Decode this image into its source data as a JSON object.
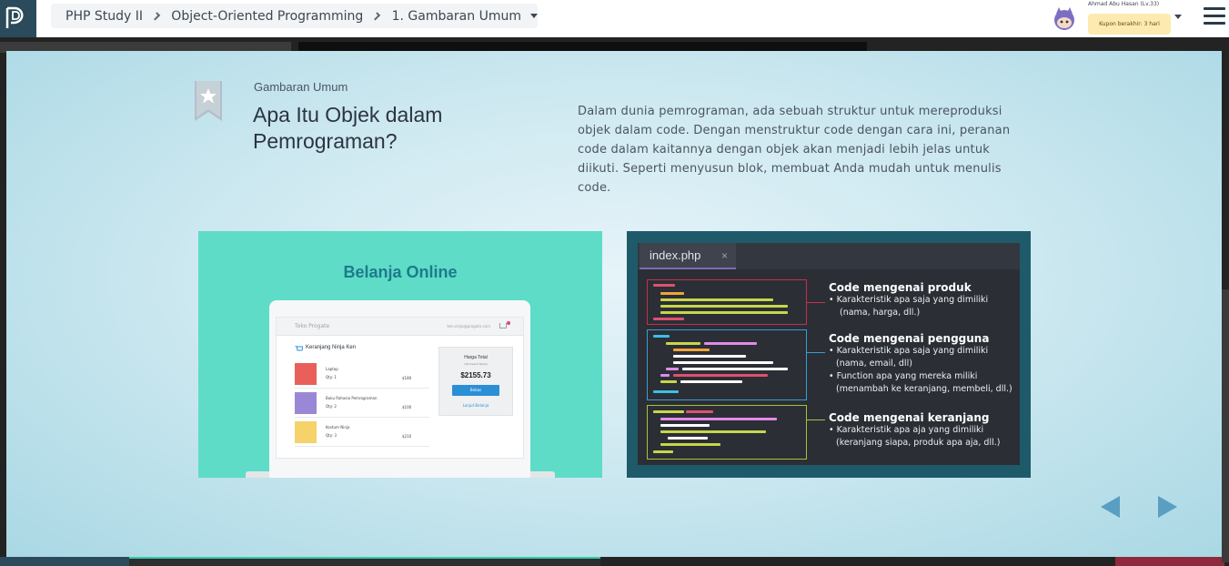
{
  "header": {
    "breadcrumb": {
      "course": "PHP Study II",
      "chapter": "Object-Oriented Programming",
      "lesson": "1. Gambaran Umum"
    },
    "user": {
      "name": "Ahmad Abu Hasan (Lv.33)",
      "coupon": "Kupon berakhir: 3 hari"
    }
  },
  "slide": {
    "subtitle": "Gambaran Umum",
    "title": "Apa Itu Objek dalam Pemrograman?",
    "description": "Dalam dunia pemrograman, ada sebuah struktur untuk mereproduksi objek dalam code. Dengan menstruktur code dengan cara ini, peranan code dalam kaitannya dengan objek akan menjadi lebih jelas untuk diikuti. Seperti menyusun blok, membuat Anda mudah untuk menulis code."
  },
  "shop_image": {
    "title": "Belanja Online",
    "store_name": "Toko Progate",
    "email": "ken.ninja@progate.com",
    "cart_title": "Keranjang Ninja Ken",
    "items": [
      {
        "name": "Laptop",
        "qty": "Qty: 1",
        "price": "$180",
        "color": "#e9605b"
      },
      {
        "name": "Buku Rahasia Pemrograman",
        "qty": "Qty: 2",
        "price": "$100",
        "color": "#9a87d6"
      },
      {
        "name": "Kostum Ninja",
        "qty": "Qty: 3",
        "price": "$210",
        "color": "#f5d26a"
      }
    ],
    "total_label": "Harga Total",
    "total_sub": "(Termasuk Pajak)",
    "total_amount": "$2155.73",
    "pay_button": "Bebas",
    "continue_link": "Lanjut Belanja"
  },
  "code_image": {
    "tab_name": "index.php",
    "tab_close": "×",
    "sections": [
      {
        "title": "Code mengenai produk",
        "lines": [
          "• Karakteristik apa saja yang dimiliki",
          "  (nama, harga, dll.)"
        ],
        "color": "#c2304f"
      },
      {
        "title": "Code mengenai pengguna",
        "lines": [
          "• Karakteristik apa saja yang dimiliki",
          "  (nama, email, dll)",
          "• Function apa yang mereka miliki",
          "  (menambah ke keranjang, membeli, dll.)"
        ],
        "color": "#3a9bd9"
      },
      {
        "title": "Code mengenai keranjang",
        "lines": [
          "• Karakteristik apa aja yang dimiliki",
          "  (keranjang siapa, produk apa aja, dll.)"
        ],
        "color": "#a8c23a"
      }
    ]
  },
  "nav": {
    "prev_icon": "triangle-left",
    "next_icon": "triangle-right",
    "arrow_color": "#5a9ec2"
  },
  "colors": {
    "brand_dark": "#2b4a5c",
    "shop_bg": "#5edcc7",
    "code_bg": "#1f5a6b",
    "editor_bg": "#2b2e35"
  }
}
